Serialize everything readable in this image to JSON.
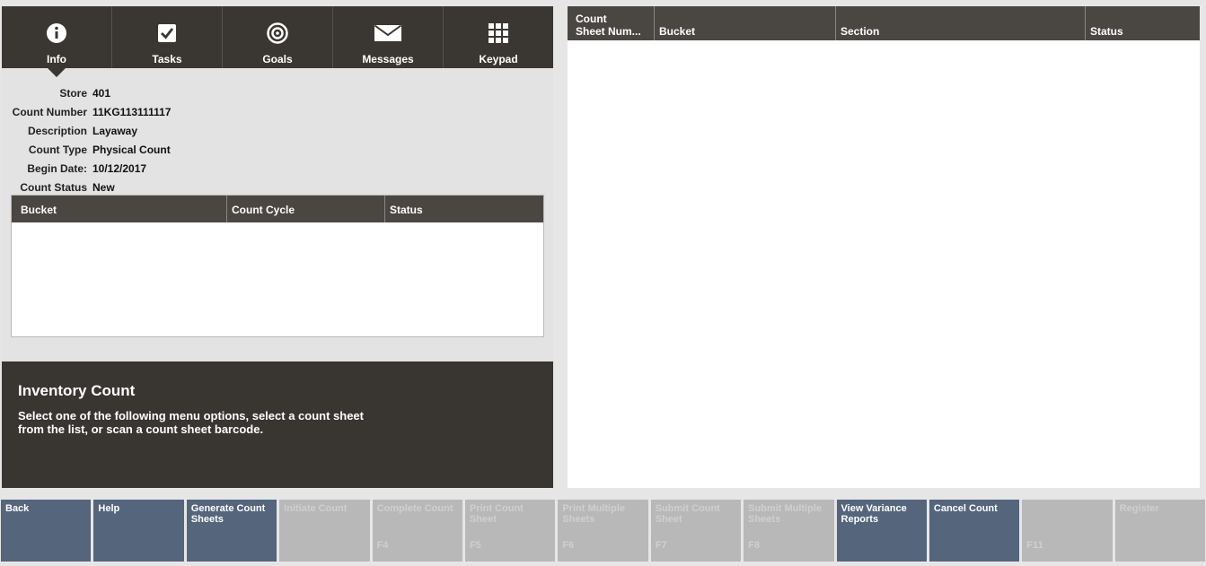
{
  "tabs": [
    {
      "label": "Info",
      "icon": "info-icon",
      "active": true
    },
    {
      "label": "Tasks",
      "icon": "checkbox-icon",
      "active": false
    },
    {
      "label": "Goals",
      "icon": "target-icon",
      "active": false
    },
    {
      "label": "Messages",
      "icon": "envelope-icon",
      "active": false
    },
    {
      "label": "Keypad",
      "icon": "keypad-icon",
      "active": false
    }
  ],
  "info": {
    "store_label": "Store",
    "store_value": "401",
    "count_number_label": "Count Number",
    "count_number_value": "11KG113111117",
    "description_label": "Description",
    "description_value": "Layaway",
    "count_type_label": "Count Type",
    "count_type_value": "Physical Count",
    "begin_date_label": "Begin Date:",
    "begin_date_value": "10/12/2017",
    "count_status_label": "Count Status",
    "count_status_value": "New"
  },
  "bucket_table": {
    "columns": [
      "Bucket",
      "Count Cycle",
      "Status"
    ],
    "rows": []
  },
  "message": {
    "title": "Inventory Count",
    "text": "Select one of the following menu options, select a count sheet from the list, or scan a count sheet barcode."
  },
  "sheet_table": {
    "columns": [
      "Count\nSheet Num...",
      "Bucket",
      "Section",
      "Status"
    ],
    "rows": []
  },
  "function_keys": [
    {
      "label": "Back",
      "key": "",
      "enabled": true
    },
    {
      "label": "Help",
      "key": "",
      "enabled": true
    },
    {
      "label": "Generate Count Sheets",
      "key": "",
      "enabled": true
    },
    {
      "label": "Initiate Count",
      "key": "",
      "enabled": false
    },
    {
      "label": "Complete Count",
      "key": "F4",
      "enabled": false
    },
    {
      "label": "Print Count Sheet",
      "key": "F5",
      "enabled": false
    },
    {
      "label": "Print Multiple Sheets",
      "key": "F6",
      "enabled": false
    },
    {
      "label": "Submit Count Sheet",
      "key": "F7",
      "enabled": false
    },
    {
      "label": "Submit Multiple Sheets",
      "key": "F8",
      "enabled": false
    },
    {
      "label": "View Variance Reports",
      "key": "",
      "enabled": true
    },
    {
      "label": "Cancel Count",
      "key": "",
      "enabled": true
    },
    {
      "label": "",
      "key": "F11",
      "enabled": false
    },
    {
      "label": "Register",
      "key": "",
      "enabled": false
    }
  ],
  "colors": {
    "tab_bar": "#3a3632",
    "header": "#4a4642",
    "button_enabled": "#54657c",
    "button_disabled": "#b8b8b8"
  }
}
